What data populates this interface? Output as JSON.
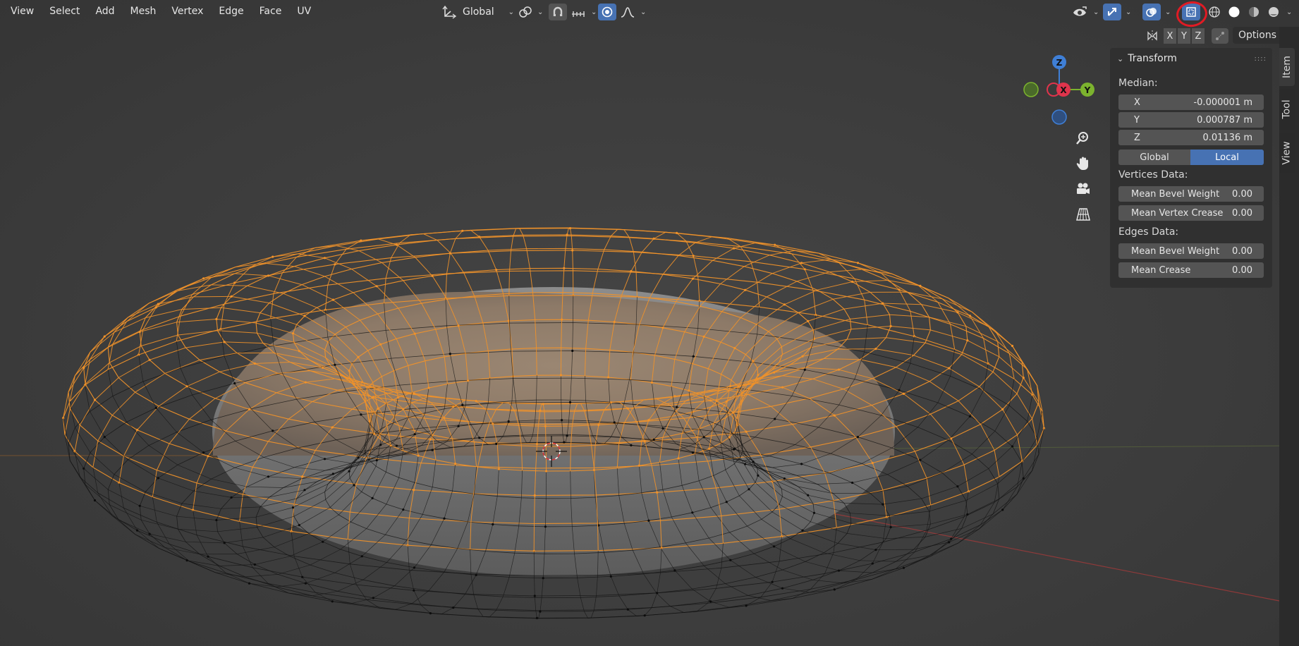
{
  "menu": {
    "items": [
      "View",
      "Select",
      "Add",
      "Mesh",
      "Vertex",
      "Edge",
      "Face",
      "UV"
    ]
  },
  "header": {
    "orientation": "Global",
    "options_label": "Options",
    "axes": [
      "X",
      "Y",
      "Z"
    ]
  },
  "gizmo": {
    "x_label": "X",
    "y_label": "Y",
    "z_label": "Z"
  },
  "npanel": {
    "title": "Transform",
    "median_label": "Median:",
    "fields": [
      {
        "key": "X",
        "value": "-0.000001 m"
      },
      {
        "key": "Y",
        "value": "0.000787 m"
      },
      {
        "key": "Z",
        "value": "0.01136 m"
      }
    ],
    "toggle": {
      "global": "Global",
      "local": "Local",
      "active": "Local"
    },
    "vertices_label": "Vertices Data:",
    "vertices_fields": [
      {
        "key": "Mean Bevel Weight",
        "value": "0.00"
      },
      {
        "key": "Mean Vertex Crease",
        "value": "0.00"
      }
    ],
    "edges_label": "Edges Data:",
    "edges_fields": [
      {
        "key": "Mean Bevel Weight",
        "value": "0.00"
      },
      {
        "key": "Mean Crease",
        "value": "0.00"
      }
    ]
  },
  "tabs": [
    "Item",
    "Tool",
    "View"
  ],
  "colors": {
    "accent": "#4772b3",
    "selection": "#f0922a",
    "highlight_ring": "#e01b24",
    "x_axis": "#e0344c",
    "y_axis": "#7cb32e",
    "z_axis": "#3f7fd6"
  },
  "icons": {
    "orientation": "transform-orientation-icon",
    "pivot": "pivot-point-icon",
    "snap": "snap-icon",
    "proportional": "proportional-editing-icon",
    "falloff": "falloff-curve-icon",
    "visibility": "eye-visibility-icon",
    "gizmo": "gizmo-toggle-icon",
    "overlays": "overlays-icon",
    "xray": "xray-toggle-icon",
    "wireframe": "wireframe-shading-icon",
    "solid": "solid-shading-icon",
    "material": "material-preview-icon",
    "rendered": "rendered-shading-icon",
    "zoom": "zoom-icon",
    "pan": "hand-pan-icon",
    "camera": "camera-view-icon",
    "ortho": "perspective-grid-icon"
  }
}
